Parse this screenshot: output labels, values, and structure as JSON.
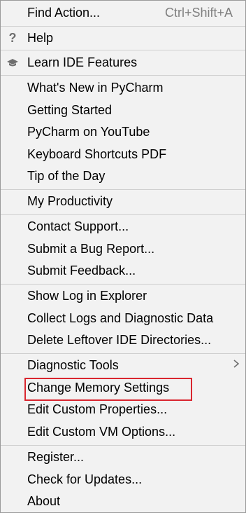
{
  "menu": {
    "find_action": {
      "label": "Find Action...",
      "shortcut": "Ctrl+Shift+A"
    },
    "help": {
      "label": "Help",
      "icon": "question-icon"
    },
    "learn": {
      "label": "Learn IDE Features",
      "icon": "graduation-cap-icon"
    },
    "whats_new": {
      "label": "What's New in PyCharm"
    },
    "getting_started": {
      "label": "Getting Started"
    },
    "youtube": {
      "label": "PyCharm on YouTube"
    },
    "shortcuts_pdf": {
      "label": "Keyboard Shortcuts PDF"
    },
    "tip_of_day": {
      "label": "Tip of the Day"
    },
    "productivity": {
      "label": "My Productivity"
    },
    "contact_support": {
      "label": "Contact Support..."
    },
    "bug_report": {
      "label": "Submit a Bug Report..."
    },
    "feedback": {
      "label": "Submit Feedback..."
    },
    "show_log": {
      "label": "Show Log in Explorer"
    },
    "collect_logs": {
      "label": "Collect Logs and Diagnostic Data"
    },
    "delete_leftover": {
      "label": "Delete Leftover IDE Directories..."
    },
    "diagnostic_tools": {
      "label": "Diagnostic Tools",
      "submenu_icon": "chevron-right-icon"
    },
    "change_memory": {
      "label": "Change Memory Settings",
      "highlight_color": "#d9262f"
    },
    "custom_properties": {
      "label": "Edit Custom Properties..."
    },
    "custom_vm": {
      "label": "Edit Custom VM Options..."
    },
    "register": {
      "label": "Register..."
    },
    "check_updates": {
      "label": "Check for Updates..."
    },
    "about": {
      "label": "About"
    }
  }
}
